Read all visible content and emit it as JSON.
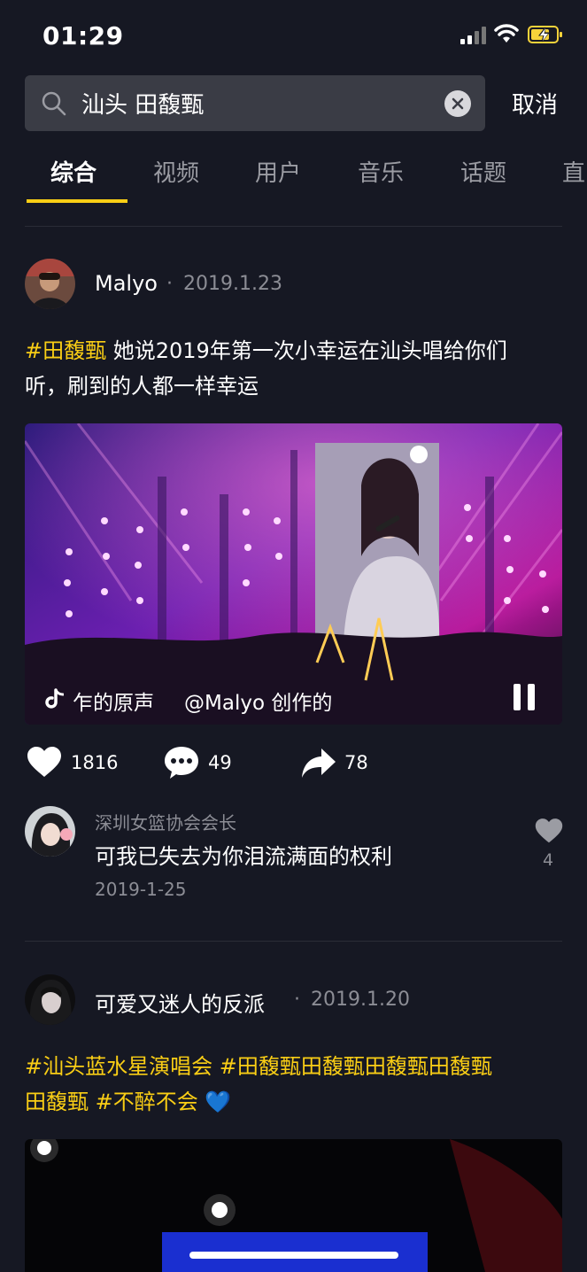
{
  "status_bar": {
    "time": "01:29"
  },
  "search": {
    "query": "汕头 田馥甄",
    "cancel_label": "取消"
  },
  "tabs": [
    {
      "label": "综合",
      "active": true
    },
    {
      "label": "视频",
      "active": false
    },
    {
      "label": "用户",
      "active": false
    },
    {
      "label": "音乐",
      "active": false
    },
    {
      "label": "话题",
      "active": false
    },
    {
      "label": "直",
      "active": false
    }
  ],
  "posts": [
    {
      "author": "Malyo",
      "date": "2019.1.23",
      "hashtag": "#田馥甄",
      "caption_line1": " 她说2019年第一次小幸运在汕头唱给你们",
      "caption_line2": "听，刷到的人都一样幸运",
      "music_text": "乍的原声",
      "creator_text": "@Malyo 创作的",
      "likes": "1816",
      "comments": "49",
      "shares": "78",
      "top_comment": {
        "author": "深圳女篮协会会长",
        "text": "可我已失去为你泪流满面的权利",
        "date": "2019-1-25",
        "likes": "4"
      }
    },
    {
      "author": "可爱又迷人的反派",
      "date": "2019.1.20",
      "caption_line1": "#汕头蓝水星演唱会 #田馥甄田馥甄田馥甄田馥甄",
      "caption_line2_tag": "田馥甄 #不醉不会",
      "emoji": "💙"
    }
  ],
  "colors": {
    "accent": "#face15",
    "background": "#161823"
  }
}
